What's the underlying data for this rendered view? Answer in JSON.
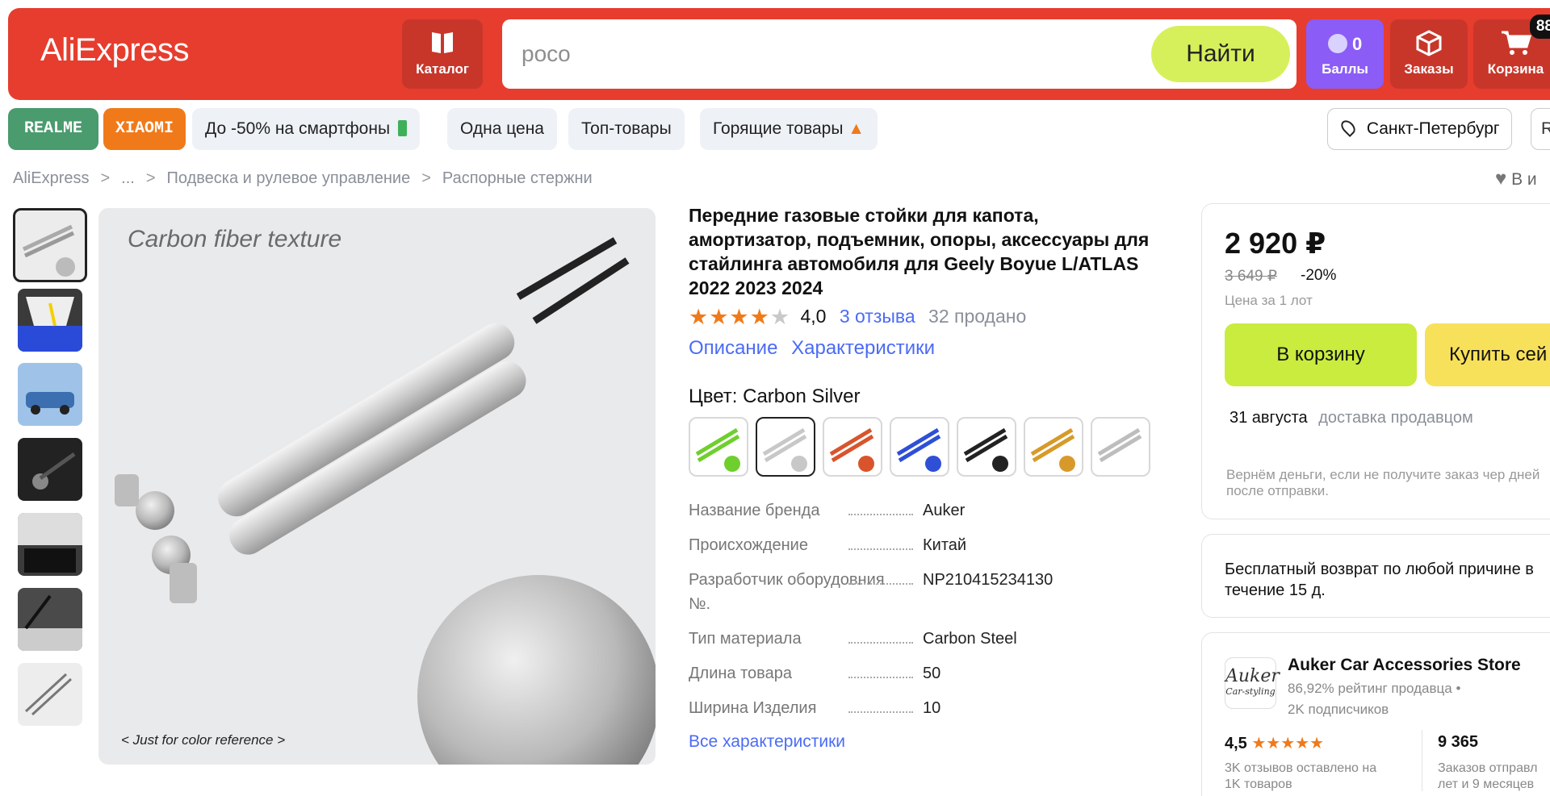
{
  "header": {
    "logo": "AliExpress",
    "catalog_label": "Каталог",
    "search_value": "poco",
    "search_button": "Найти",
    "points_count": "0",
    "points_label": "Баллы",
    "orders_label": "Заказы",
    "cart_label": "Корзина",
    "cart_count": "88"
  },
  "chips": {
    "realme": "REALME",
    "xiaomi": "XIAOMI",
    "items": [
      "До -50% на смартфоны",
      "Одна цена",
      "Топ-товары",
      "Горящие товары"
    ],
    "city": "Санкт-Петербург",
    "city_extra": "R"
  },
  "breadcrumb": [
    "AliExpress",
    "...",
    "Подвеска и рулевое управление",
    "Распорные стержни"
  ],
  "favorite_label": "В и",
  "gallery": {
    "caption": "Carbon fiber texture",
    "note": "< Just for color reference >"
  },
  "product": {
    "title": "Передние газовые стойки для капота, амортизатор, подъемник, опоры, аксессуары для стайлинга автомобиля для Geely Boyue L/ATLAS 2022 2023 2024",
    "rating": "4,0",
    "rating_value": 4.0,
    "reviews": "3 отзыва",
    "sold": "32 продано",
    "tab_description": "Описание",
    "tab_specs": "Характеристики",
    "color_label": "Цвет: Carbon Silver",
    "swatch_colors": [
      "#6fcf2e",
      "#c8c8c8",
      "#d9542c",
      "#2e4fd6",
      "#222222",
      "#d79a2a",
      "#bdbdbd"
    ],
    "specs": [
      {
        "k": "Название бренда",
        "v": "Auker"
      },
      {
        "k": "Происхождение",
        "v": "Китай"
      },
      {
        "k": "Разработчик оборудовния",
        "k2": "№.",
        "v": "NP210415234130"
      },
      {
        "k": "Тип материала",
        "v": "Carbon Steel"
      },
      {
        "k": "Длина товара",
        "v": "50"
      },
      {
        "k": "Ширина Изделия",
        "v": "10"
      }
    ],
    "all_specs": "Все характеристики"
  },
  "buy": {
    "price": "2 920 ₽",
    "old_price": "3 649 ₽",
    "discount": "-20%",
    "per_lot": "Цена за 1 лот",
    "to_cart": "В корзину",
    "buy_now": "Купить сей",
    "delivery_date": "31 августа",
    "delivery_by": "доставка продавцом",
    "refund_note": "Вернём деньги, если не получите заказ чер дней после отправки."
  },
  "returns": {
    "text": "Бесплатный возврат по любой причине в течение 15 д."
  },
  "store": {
    "logo_line1": "Auker",
    "logo_line2": "Car-styling",
    "name": "Auker Car Accessories Store",
    "seller_rating": "86,92% рейтинг продавца",
    "followers": "2K подписчиков",
    "stat1_value": "4,5",
    "stat1_label": "3K отзывов оставлено на 1K товаров",
    "stat2_value": "9 365",
    "stat2_label": "Заказов отправл лет и 9 месяцев"
  }
}
